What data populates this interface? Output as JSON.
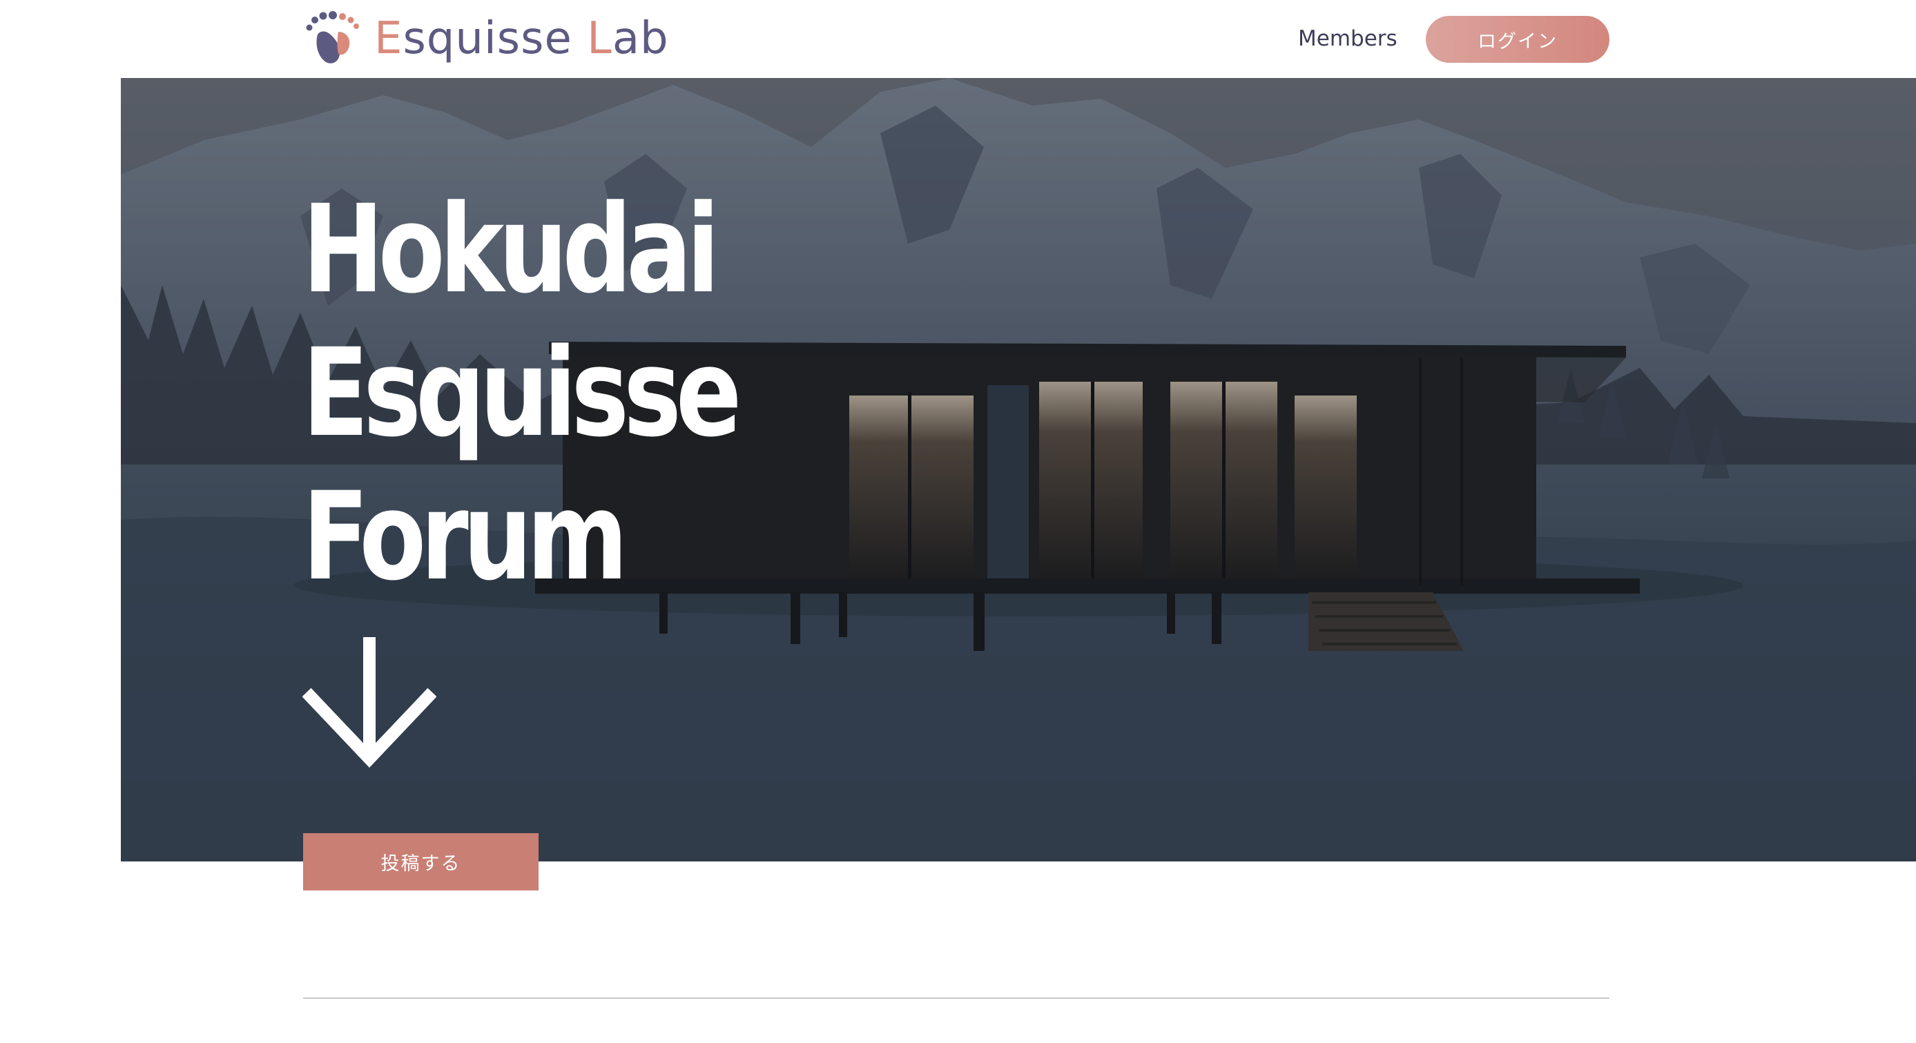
{
  "header": {
    "logo": {
      "text_first_letter": "E",
      "text_part1": "squisse ",
      "text_second_letter": "L",
      "text_part2": "ab",
      "icon": "footprint-logo-icon"
    },
    "nav": {
      "members_label": "Members",
      "login_label": "ログイン"
    }
  },
  "hero": {
    "title_lines": [
      "Hokudai",
      "Esquisse",
      "Forum"
    ],
    "scroll_icon": "arrow-down-icon",
    "background": "snowy mountain cabin image"
  },
  "actions": {
    "post_label": "投稿する"
  },
  "colors": {
    "brand_purple": "#5d5a82",
    "brand_salmon": "#d98a7b",
    "login_gradient_start": "#dba39c",
    "login_gradient_end": "#d3877e",
    "post_button": "#c97f74",
    "hero_overlay": "#3a4554"
  }
}
